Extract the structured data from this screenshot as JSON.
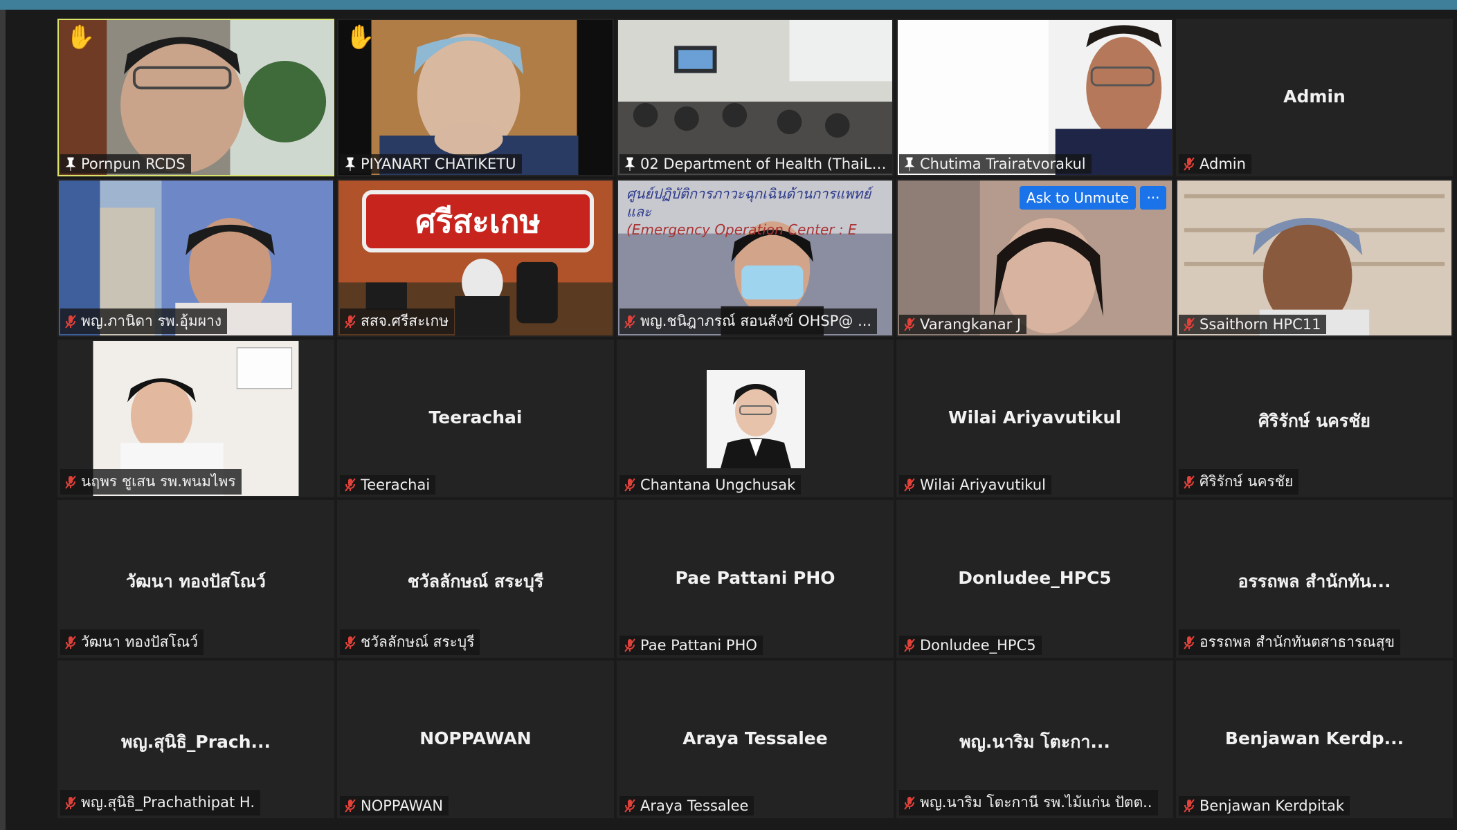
{
  "colors": {
    "top_bar": "#3f7f9a",
    "active_border": "#d8e46a",
    "raised_hand": "#f6b32a",
    "unmute_button": "#1a73e8",
    "muted_icon": "#e0413a"
  },
  "tiles": [
    {
      "label": "Pornpun RCDS",
      "pinned": true,
      "hand_raised": true,
      "video": true,
      "active": true
    },
    {
      "label": "PIYANART CHATIKETU",
      "pinned": true,
      "hand_raised": true,
      "video": true
    },
    {
      "label": "02 Department of Health (ThaiLa...",
      "pinned": true,
      "video": true
    },
    {
      "label": "Chutima Trairatvorakul",
      "pinned": true,
      "video": true
    },
    {
      "label": "Admin",
      "muted": true,
      "center": "Admin"
    },
    {
      "label": "พญ.ภานิดา รพ.อุ้มผาง",
      "muted": true,
      "video": true
    },
    {
      "label": "สสจ.ศรีสะเกษ",
      "muted": true,
      "video": true,
      "sign": "ศรีสะเกษ"
    },
    {
      "label": "พญ.ชนิฎาภรณ์ สอนสังข์ OHSP@ ...",
      "muted": true,
      "video": true,
      "banner_line1": "ศูนย์ปฏิบัติการภาวะฉุกเฉินด้านการแพทย์และ",
      "banner_line2": "(Emergency Operation Center : E"
    },
    {
      "label": "Varangkanar J",
      "muted": true,
      "video": true,
      "ask_unmute": "Ask to Unmute",
      "more": "···"
    },
    {
      "label": "Ssaithorn HPC11",
      "muted": true,
      "video": true
    },
    {
      "label": "นฤพร ชูเสน รพ.พนมไพร",
      "muted": true,
      "video": true
    },
    {
      "label": "Teerachai",
      "muted": true,
      "center": "Teerachai"
    },
    {
      "label": "Chantana Ungchusak",
      "muted": true,
      "photo": true
    },
    {
      "label": "Wilai Ariyavutikul",
      "muted": true,
      "center": "Wilai Ariyavutikul"
    },
    {
      "label": "ศิริรักษ์ นครชัย",
      "muted": true,
      "center": "ศิริรักษ์ นครชัย"
    },
    {
      "label": "วัฒนา ทองปัสโณว์",
      "muted": true,
      "center": "วัฒนา ทองปัสโณว์"
    },
    {
      "label": "ชวัลลักษณ์ สระบุรี",
      "muted": true,
      "center": "ชวัลลักษณ์ สระบุรี"
    },
    {
      "label": "Pae Pattani PHO",
      "muted": true,
      "center": "Pae Pattani PHO"
    },
    {
      "label": "Donludee_HPC5",
      "muted": true,
      "center": "Donludee_HPC5"
    },
    {
      "label": "อรรถพล สำนักทันตสาธารณสุข",
      "muted": true,
      "center": "อรรถพล สำนักทัน..."
    },
    {
      "label": "พญ.สุนิธิ_Prachathipat H.",
      "muted": true,
      "center": "พญ.สุนิธิ_Prach..."
    },
    {
      "label": "NOPPAWAN",
      "muted": true,
      "center": "NOPPAWAN"
    },
    {
      "label": "Araya Tessalee",
      "muted": true,
      "center": "Araya Tessalee"
    },
    {
      "label": "พญ.นาริม โตะกานี รพ.ไม้แก่น ปัตต..",
      "muted": true,
      "center": "พญ.นาริม โตะกา..."
    },
    {
      "label": "Benjawan Kerdpitak",
      "muted": true,
      "center": "Benjawan  Kerdp..."
    }
  ]
}
